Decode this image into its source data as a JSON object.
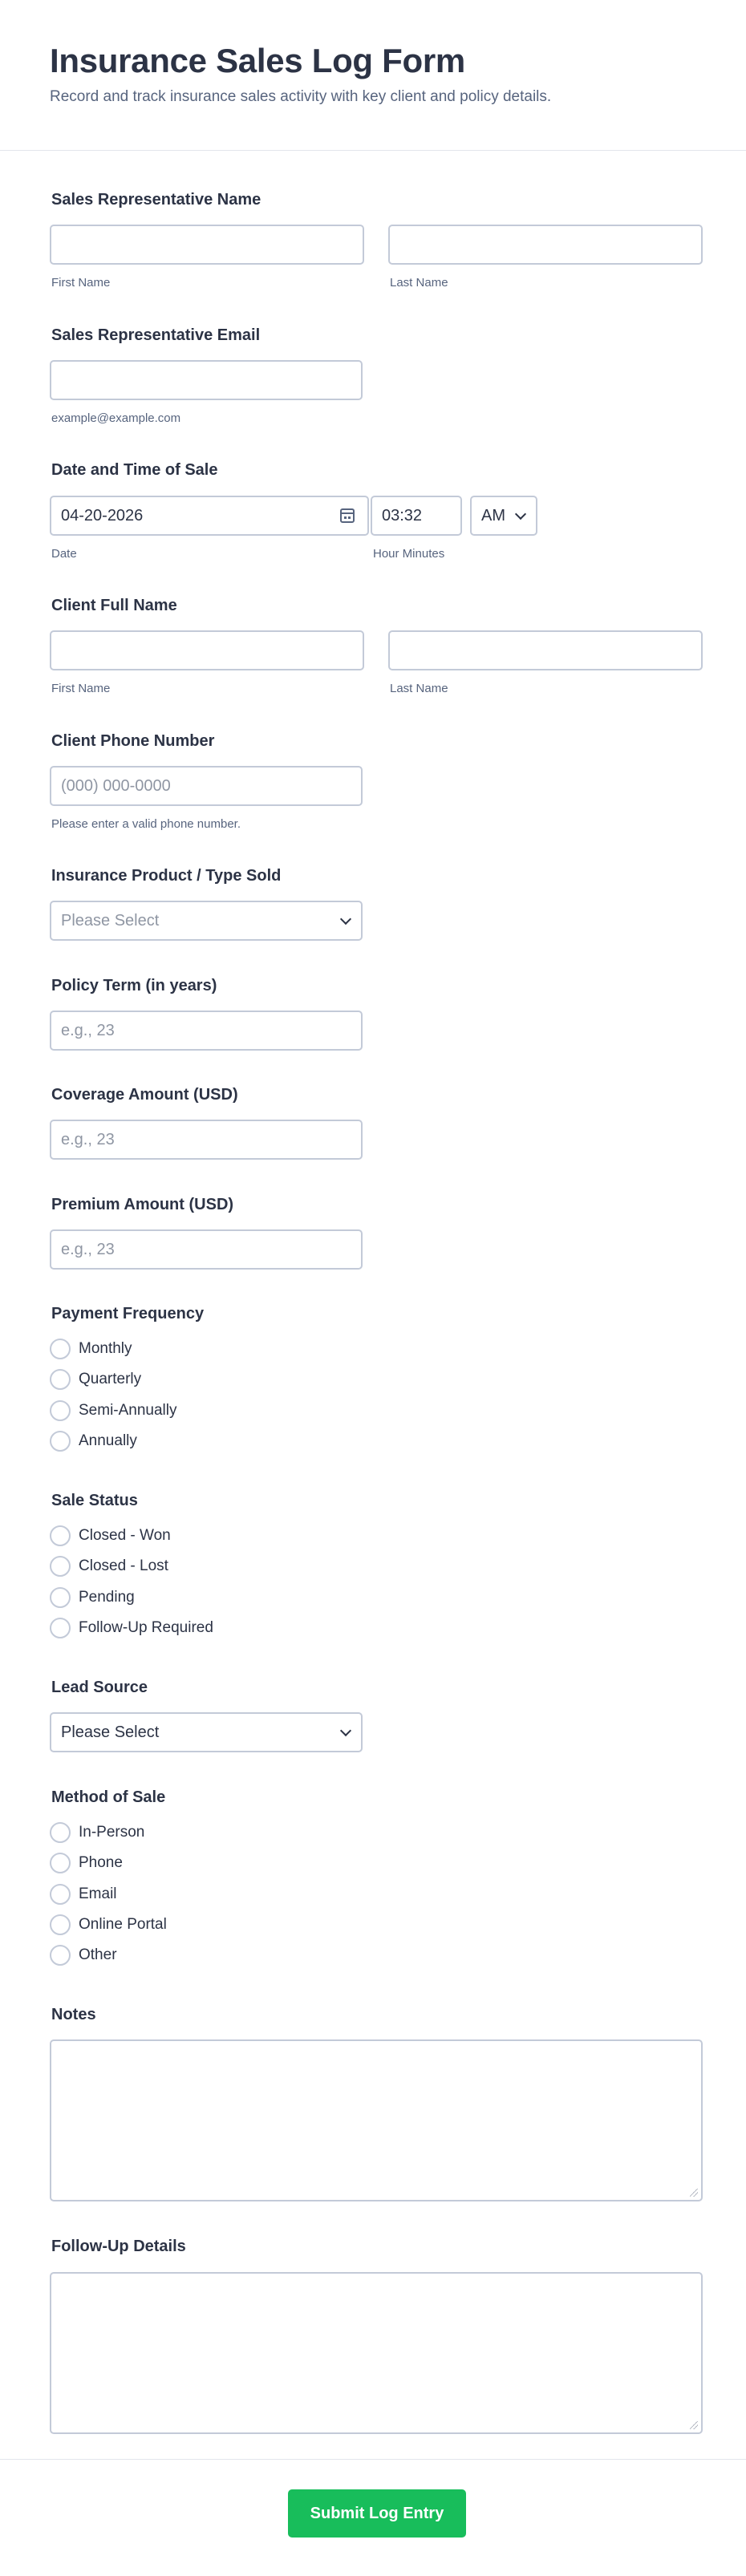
{
  "header": {
    "title": "Insurance Sales Log Form",
    "subtitle": "Record and track insurance sales activity with key client and policy details."
  },
  "rep_name": {
    "label": "Sales Representative Name",
    "first_sub": "First Name",
    "last_sub": "Last Name",
    "first_value": "",
    "last_value": ""
  },
  "rep_email": {
    "label": "Sales Representative Email",
    "value": "",
    "sub": "example@example.com"
  },
  "datetime": {
    "label": "Date and Time of Sale",
    "date_value": "04-20-2026",
    "time_value": "03:32",
    "ampm_value": "AM",
    "date_sub": "Date",
    "time_sub": "Hour Minutes"
  },
  "client_name": {
    "label": "Client Full Name",
    "first_sub": "First Name",
    "last_sub": "Last Name",
    "first_value": "",
    "last_value": ""
  },
  "client_phone": {
    "label": "Client Phone Number",
    "placeholder": "(000) 000-0000",
    "sub": "Please enter a valid phone number."
  },
  "product": {
    "label": "Insurance Product / Type Sold",
    "selected": "Please Select"
  },
  "policy_term": {
    "label": "Policy Term (in years)",
    "placeholder": "e.g., 23"
  },
  "coverage": {
    "label": "Coverage Amount (USD)",
    "placeholder": "e.g., 23"
  },
  "premium": {
    "label": "Premium Amount (USD)",
    "placeholder": "e.g., 23"
  },
  "payment_frequency": {
    "label": "Payment Frequency",
    "options": [
      "Monthly",
      "Quarterly",
      "Semi-Annually",
      "Annually"
    ]
  },
  "sale_status": {
    "label": "Sale Status",
    "options": [
      "Closed - Won",
      "Closed - Lost",
      "Pending",
      "Follow-Up Required"
    ]
  },
  "lead_source": {
    "label": "Lead Source",
    "selected": "Please Select"
  },
  "method": {
    "label": "Method of Sale",
    "options": [
      "In-Person",
      "Phone",
      "Email",
      "Online Portal",
      "Other"
    ]
  },
  "notes": {
    "label": "Notes",
    "value": ""
  },
  "follow_up": {
    "label": "Follow-Up Details",
    "value": ""
  },
  "submit": {
    "label": "Submit Log Entry"
  },
  "colors": {
    "submit_bg": "#18bd5b",
    "text": "#2c3345",
    "muted": "#57647e",
    "border": "#c3cad8"
  }
}
